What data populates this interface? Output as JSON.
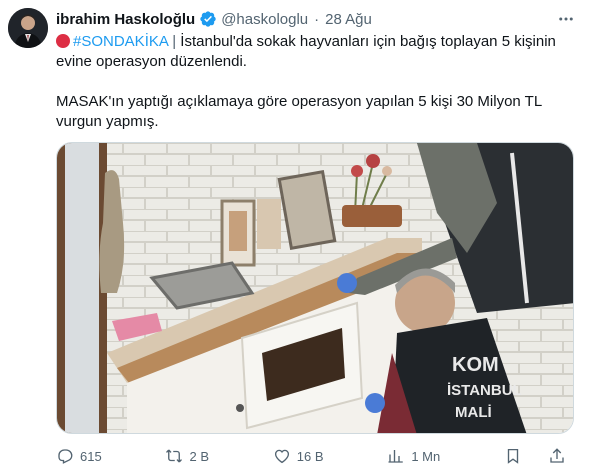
{
  "author": {
    "name": "ibrahim Haskoloğlu",
    "handle": "@haskologlu",
    "separator": "·",
    "date": "28 Ağu",
    "verified_color": "#1d9bf0"
  },
  "tweet": {
    "hashtag": "#SONDAKİKA",
    "separator": "|",
    "line1_rest": "İstanbul'da sokak hayvanları için bağış toplayan 5 kişinin evine operasyon düzenlendi.",
    "paragraph2": "MASAK'ın yaptığı açıklamaya göre operasyon yapılan 5 kişi 30 Milyon TL vurgun yapmış."
  },
  "media": {
    "vest_text": [
      "KOM",
      "İSTANBUL",
      "MALİ"
    ]
  },
  "actions": {
    "replies": "615",
    "retweets": "2 B",
    "likes": "16 B",
    "views": "1 Mn"
  },
  "colors": {
    "accent": "#1d9bf0",
    "secondary_text": "#536471",
    "breaking_red": "#dd2e44"
  },
  "icons": [
    "verified-badge-icon",
    "more-icon",
    "red-circle-icon",
    "reply-icon",
    "retweet-icon",
    "like-icon",
    "views-icon",
    "bookmark-icon",
    "share-icon"
  ]
}
